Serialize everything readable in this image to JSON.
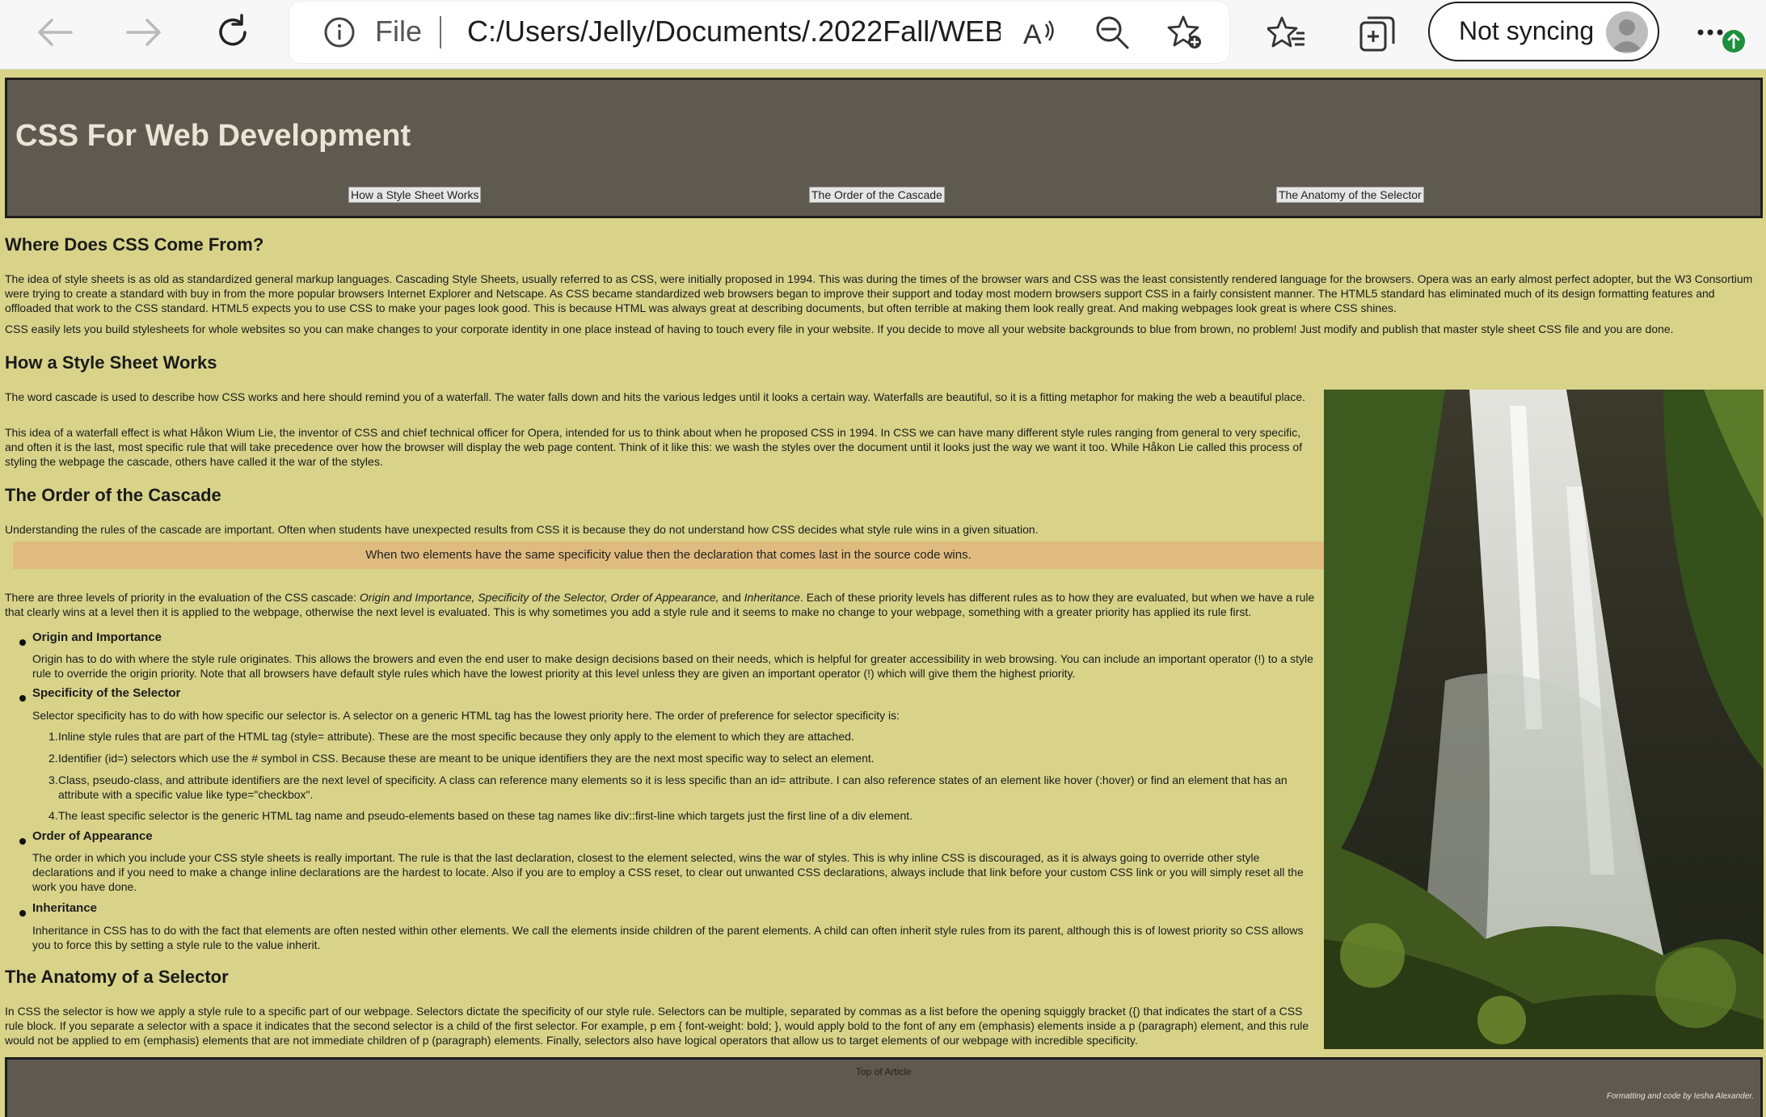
{
  "browser": {
    "back_label": "Back",
    "forward_label": "Forward",
    "refresh_label": "Refresh",
    "address": {
      "scheme_label": "File",
      "url": "C:/Users/Jelly/Documents/.2022Fall/WEB..."
    },
    "sync_button_label": "Not syncing",
    "accent": "#1e8e3e"
  },
  "page": {
    "title": "CSS For Web Development",
    "nav": [
      {
        "label": "How a Style Sheet Works"
      },
      {
        "label": "The Order of the Cascade"
      },
      {
        "label": "The Anatomy of the Selector"
      }
    ],
    "sections": {
      "where": {
        "heading": "Where Does CSS Come From?",
        "p1": "The idea of style sheets is as old as standardized general markup languages. Cascading Style Sheets, usually referred to as CSS, were initially proposed in 1994. This was during the times of the browser wars and CSS was the least consistently rendered language for the browsers. Opera was an early almost perfect adopter, but the W3 Consortium were trying to create a standard with buy in from the more popular browsers Internet Explorer and Netscape. As CSS became standardized web browsers began to improve their support and today most modern browsers support CSS in a fairly consistent manner. The HTML5 standard has eliminated much of its design formatting features and offloaded that work to the CSS standard. HTML5 expects you to use CSS to make your pages look good. This is because HTML was always great at describing documents, but often terrible at making them look really great. And making webpages look great is where CSS shines.",
        "p2": "CSS easily lets you build stylesheets for whole websites so you can make changes to your corporate identity in one place instead of having to touch every file in your website. If you decide to move all your website backgrounds to blue from brown, no problem! Just modify and publish that master style sheet CSS file and you are done."
      },
      "how": {
        "heading": "How a Style Sheet Works",
        "p1": "The word cascade is used to describe how CSS works and here should remind you of a waterfall. The water falls down and hits the various ledges until it looks a certain way. Waterfalls are beautiful, so it is a fitting metaphor for making the web a beautiful place.",
        "p2": "This idea of a waterfall effect is what Håkon Wium Lie, the inventor of CSS and chief technical officer for Opera, intended for us to think about when he proposed CSS in 1994. In CSS we can have many different style rules ranging from general to very specific, and often it is the last, most specific rule that will take precedence over how the browser will display the web page content. Think of it like this: we wash the styles over the document until it looks just the way we want it too. While Håkon Lie called this process of styling the webpage the cascade, others have called it the war of the styles."
      },
      "order": {
        "heading": "The Order of the Cascade",
        "p1": "Understanding the rules of the cascade are important. Often when students have unexpected results from CSS it is because they do not understand how CSS decides what style rule wins in a given situation.",
        "callout": "When two elements have the same specificity value then the declaration that comes last in the source code wins.",
        "p2_a": "There are three levels of priority in the evaluation of the CSS cascade: ",
        "p2_em": "Origin and Importance, Specificity of the Selector, Order of Appearance,",
        "p2_and": " and ",
        "p2_em2": "Inheritance",
        "p2_b": ". Each of these priority levels has different rules as to how they are evaluated, but when we have a rule that clearly wins at a level then it is applied to the webpage, otherwise the next level is evaluated. This is why sometimes you add a style rule and it seems to make no change to your webpage, something with a greater priority has applied its rule first.",
        "levels": [
          {
            "title": "Origin and Importance",
            "text": "Origin has to do with where the style rule originates. This allows the browers and even the end user to make design decisions based on their needs, which is helpful for greater accessibility in web browsing. You can include an important operator (!) to a style rule to override the origin priority. Note that all browsers have default style rules which have the lowest priority at this level unless they are given an important operator (!) which will give them the highest priority."
          },
          {
            "title": "Specificity of the Selector",
            "text": "Selector specificity has to do with how specific our selector is. A selector on a generic HTML tag has the lowest priority here. The order of preference for selector specificity is:",
            "items": [
              "Inline style rules that are part of the HTML tag (style= attribute). These are the most specific because they only apply to the element to which they are attached.",
              "Identifier (id=) selectors which use the # symbol in CSS. Because these are meant to be unique identifiers they are the next most specific way to select an element.",
              "Class, pseudo-class, and attribute identifiers are the next level of specificity. A class can reference many elements so it is less specific than an id= attribute. I can also reference states of an element like hover (:hover) or find an element that has an attribute with a specific value like type=\"checkbox\".",
              "The least specific selector is the generic HTML tag name and pseudo-elements based on these tag names like div::first-line which targets just the first line of a div element."
            ]
          },
          {
            "title": "Order of Appearance",
            "text": "The order in which you include your CSS style sheets is really important. The rule is that the last declaration, closest to the element selected, wins the war of styles. This is why inline CSS is discouraged, as it is always going to override other style declarations and if you need to make a change inline declarations are the hardest to locate. Also if you are to employ a CSS reset, to clear out unwanted CSS declarations, always include that link before your custom CSS link or you will simply reset all the work you have done."
          },
          {
            "title": "Inheritance",
            "text": "Inheritance in CSS has to do with the fact that elements are often nested within other elements. We call the elements inside children of the parent elements. A child can often inherit style rules from its parent, although this is of lowest priority so CSS allows you to force this by setting a style rule to the value inherit."
          }
        ]
      },
      "anatomy": {
        "heading": "The Anatomy of a Selector",
        "p1": "In CSS the selector is how we apply a style rule to a specific part of our webpage. Selectors dictate the specificity of our style rule. Selectors can be multiple, separated by commas as a list before the opening squiggly bracket ({) that indicates the start of a CSS rule block. If you separate a selector with a space it indicates that the second selector is a child of the first selector. For example, p em { font-weight: bold; }, would apply bold to the font of any em (emphasis) elements inside a p (paragraph) element, and this rule would not be applied to em (emphasis) elements that are not immediate children of p (paragraph) elements. Finally, selectors also have logical operators that allow us to target elements of our webpage with incredible specificity."
      }
    },
    "footer": {
      "top_link": "Top of Article",
      "credit": "Formatting and code by Iesha Alexander."
    }
  }
}
